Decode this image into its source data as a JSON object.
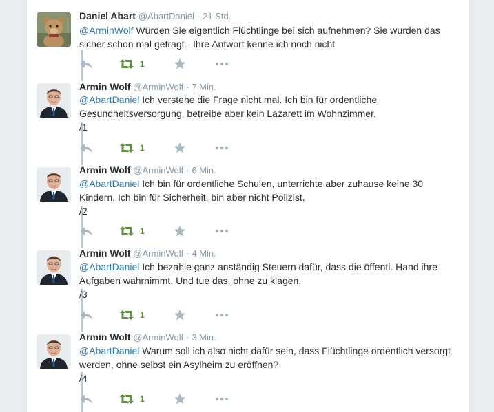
{
  "tweets": [
    {
      "name": "Daniel Abart",
      "handle": "@AbartDaniel",
      "separator": "·",
      "time": "21 Std.",
      "mention": "@ArminWolf",
      "body": " Würden Sie eigentlich Flüchtlinge bei sich aufnehmen? Sie wurden das sicher schon mal gefragt - Ihre Antwort kenne ich noch nicht",
      "suffix": "",
      "retweets": "1",
      "avatar": "teddy-bear"
    },
    {
      "name": "Armin Wolf",
      "handle": "@ArminWolf",
      "separator": "·",
      "time": "7 Min.",
      "mention": "@AbartDaniel",
      "body": " Ich verstehe die Frage nicht mal. Ich bin für ordentliche Gesundheitsversorgung, betreibe aber kein Lazarett im Wohnzimmer.",
      "suffix": "/1",
      "retweets": "1",
      "avatar": "man-portrait"
    },
    {
      "name": "Armin Wolf",
      "handle": "@ArminWolf",
      "separator": "·",
      "time": "6 Min.",
      "mention": "@AbartDaniel",
      "body": " Ich bin für ordentliche Schulen, unterrichte aber zuhause keine 30 Kindern. Ich bin für Sicherheit, bin aber nicht Polizist.",
      "suffix": "/2",
      "retweets": "1",
      "avatar": "man-portrait"
    },
    {
      "name": "Armin Wolf",
      "handle": "@ArminWolf",
      "separator": "·",
      "time": "4 Min.",
      "mention": "@AbartDaniel",
      "body": " Ich bezahle ganz anständig Steuern dafür, dass die öffentl. Hand ihre Aufgaben wahrnimmt. Und tue das, ohne zu klagen.",
      "suffix": "/3",
      "retweets": "1",
      "avatar": "man-portrait"
    },
    {
      "name": "Armin Wolf",
      "handle": "@ArminWolf",
      "separator": "·",
      "time": "3 Min.",
      "mention": "@AbartDaniel",
      "body": " Warum soll ich also nicht dafür sein, dass Flüchtlinge ordentlich versorgt werden, ohne selbst ein Asylheim zu eröffnen?",
      "suffix": "/4",
      "retweets": "1",
      "avatar": "man-portrait"
    }
  ],
  "colors": {
    "mention": "#2b7bb9",
    "retweeted": "#5c913b",
    "thread_line": "#a9ccdf",
    "muted": "#8899a6"
  },
  "icons": [
    "reply-icon",
    "retweet-icon",
    "favorite-icon",
    "more-icon"
  ]
}
